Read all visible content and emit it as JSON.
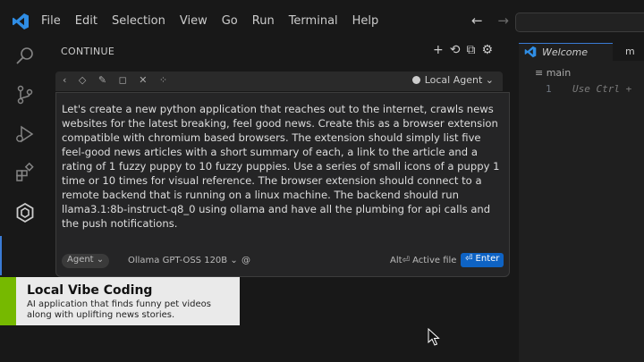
{
  "menu": [
    "File",
    "Edit",
    "Selection",
    "View",
    "Go",
    "Run",
    "Terminal",
    "Help"
  ],
  "nav": {
    "back": "←",
    "forward": "→"
  },
  "panel": {
    "title": "CONTINUE",
    "agent_selector": "Local Agent",
    "prompt": "Let's create a new python application that reaches out to the internet, crawls news websites for the latest breaking, feel good news. Create this as a browser extension compatible with chromium based browsers. The extension should simply list five feel-good news articles with a short summary of each, a link to the article and a rating of 1 fuzzy puppy to 10 fuzzy puppies. Use a series of small icons of a puppy 1 time or 10 times for visual reference. The browser extension should connect to a remote backend that is running on a linux machine. The backend should run llama3.1:8b-instruct-q8_0 using ollama and have all the plumbing for api calls and the push notifications.",
    "mode_chip": "Agent",
    "model": "Ollama GPT-OSS 120B",
    "at_symbol": "@",
    "active_file_hint": "Alt⏎ Active file",
    "enter_label": "⏎ Enter"
  },
  "editor": {
    "tab_welcome": "Welcome",
    "tab_second": "m",
    "breadcrumb": "main",
    "line_number": "1",
    "placeholder": "Use Ctrl +"
  },
  "lower_third": {
    "title": "Local Vibe Coding",
    "subtitle": "AI application that finds funny pet videos along with uplifting news stories."
  },
  "colors": {
    "accent_blue": "#0e63c4",
    "accent_green": "#76b900"
  }
}
